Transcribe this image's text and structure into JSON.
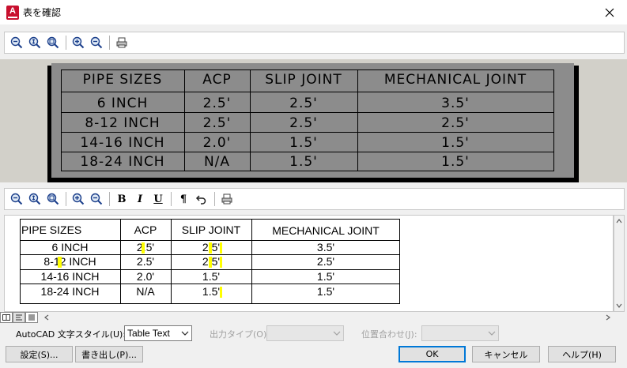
{
  "window": {
    "title": "表を確認",
    "app_icon": "A"
  },
  "toolbar_top": {
    "icons": [
      "zoom-out-icon",
      "zoom-extents-icon",
      "zoom-window-icon",
      "zoom-in-icon",
      "zoom-out-small-icon",
      "print-icon"
    ]
  },
  "toolbar_editor": {
    "bold": "B",
    "italic": "I",
    "underline": "U",
    "paragraph": "¶"
  },
  "preview": {
    "headers": [
      "PIPE SIZES",
      "ACP",
      "SLIP JOINT",
      "MECHANICAL JOINT"
    ],
    "rows": [
      [
        "6 INCH",
        "2.5'",
        "2.5'",
        "3.5'"
      ],
      [
        "8-12 INCH",
        "2.5'",
        "2.5'",
        "2.5'"
      ],
      [
        "14-16 INCH",
        "2.0'",
        "1.5'",
        "1.5'"
      ],
      [
        "18-24 INCH",
        "N/A",
        "1.5'",
        "1.5'"
      ]
    ]
  },
  "editor": {
    "headers": [
      "PIPE SIZES",
      "ACP",
      "SLIP JOINT",
      "MECHANICAL JOINT"
    ],
    "rows": [
      [
        "6 INCH",
        "2.5'",
        "2.5'",
        "3.5'"
      ],
      [
        "8-12 INCH",
        "2.5'",
        "2.5'",
        "2.5'"
      ],
      [
        "14-16 INCH",
        "2.0'",
        "1.5'",
        "1.5'"
      ],
      [
        "18-24 INCH",
        "N/A",
        "1.5'",
        "1.5'"
      ]
    ]
  },
  "form": {
    "text_style_label": "AutoCAD 文字スタイル(U):",
    "text_style_value": "Table Text",
    "output_type_label": "出力タイプ(O):",
    "alignment_label": "位置合わせ(J):"
  },
  "buttons": {
    "settings": "設定(S)...",
    "export": "書き出し(P)...",
    "ok": "OK",
    "cancel": "キャンセル",
    "help": "ヘルプ(H)"
  }
}
